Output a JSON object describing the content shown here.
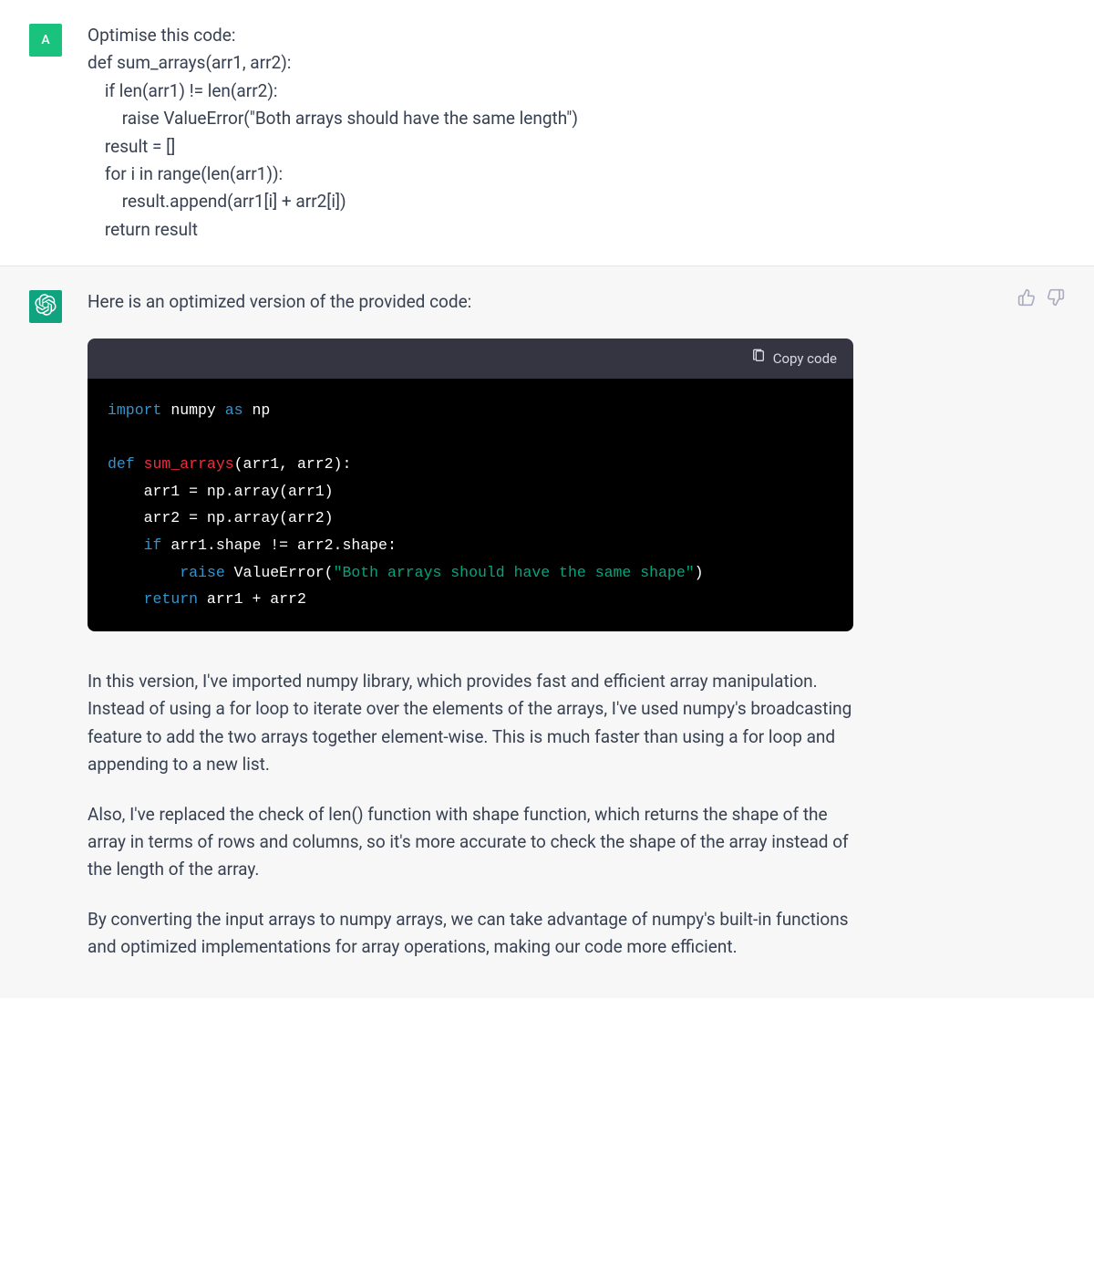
{
  "user": {
    "avatar_letter": "A",
    "prompt_intro": "Optimise this code:",
    "code_lines": [
      "def sum_arrays(arr1, arr2):",
      "    if len(arr1) != len(arr2):",
      "        raise ValueError(\"Both arrays should have the same length\")",
      "    result = []",
      "    for i in range(len(arr1)):",
      "        result.append(arr1[i] + arr2[i])",
      "    return result"
    ]
  },
  "assistant": {
    "intro": "Here is an optimized version of the provided code:",
    "copy_label": "Copy code",
    "code": {
      "line1": {
        "kw": "import",
        "rest": " numpy ",
        "as": "as",
        "tail": " np"
      },
      "blank": "",
      "line2": {
        "kw": "def",
        "fn": " sum_arrays",
        "sig": "(arr1, arr2):"
      },
      "line3": "    arr1 = np.array(arr1)",
      "line4": "    arr2 = np.array(arr2)",
      "line5": {
        "indent": "    ",
        "kw": "if",
        "rest": " arr1.shape != arr2.shape:"
      },
      "line6": {
        "indent": "        ",
        "kw": "raise",
        "mid": " ValueError(",
        "str": "\"Both arrays should have the same shape\"",
        "end": ")"
      },
      "line7": {
        "indent": "    ",
        "kw": "return",
        "rest": " arr1 + arr2"
      }
    },
    "para1": "In this version, I've imported numpy library, which provides fast and efficient array manipulation. Instead of using a for loop to iterate over the elements of the arrays, I've used numpy's broadcasting feature to add the two arrays together element-wise. This is much faster than using a for loop and appending to a new list.",
    "para2": "Also, I've replaced the check of len() function with shape function, which returns the shape of the array in terms of rows and columns, so it's more accurate to check the shape of the array instead of the length of the array.",
    "para3": "By converting the input arrays to numpy arrays, we can take advantage of numpy's built-in functions and optimized implementations for array operations, making our code more efficient."
  }
}
